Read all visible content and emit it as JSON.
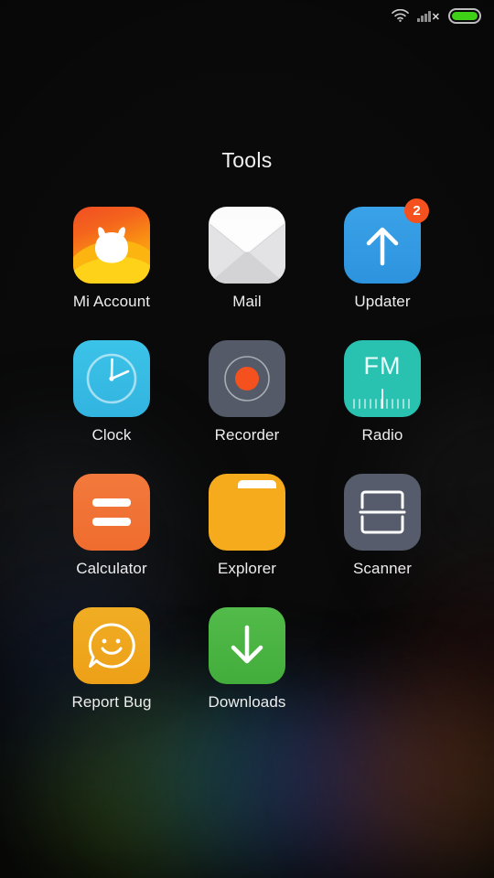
{
  "statusbar": {
    "wifi_icon": "wifi-icon",
    "signal_icon": "signal-bars-icon",
    "no_sim_mark": "✕",
    "battery_icon": "battery-full-icon"
  },
  "page": {
    "title": "Tools"
  },
  "apps": [
    {
      "label": "Mi Account",
      "icon": "mi-account-icon",
      "badge": null
    },
    {
      "label": "Mail",
      "icon": "mail-envelope-icon",
      "badge": null
    },
    {
      "label": "Updater",
      "icon": "updater-up-arrow-icon",
      "badge": "2"
    },
    {
      "label": "Clock",
      "icon": "clock-face-icon",
      "badge": null
    },
    {
      "label": "Recorder",
      "icon": "record-dot-icon",
      "badge": null
    },
    {
      "label": "Radio",
      "icon": "fm-radio-icon",
      "badge": null,
      "fm_text": "FM"
    },
    {
      "label": "Calculator",
      "icon": "equals-sign-icon",
      "badge": null
    },
    {
      "label": "Explorer",
      "icon": "folder-icon",
      "badge": null
    },
    {
      "label": "Scanner",
      "icon": "scanner-bars-icon",
      "badge": null
    },
    {
      "label": "Report Bug",
      "icon": "smiley-speech-bubble-icon",
      "badge": null
    },
    {
      "label": "Downloads",
      "icon": "download-arrow-icon",
      "badge": null
    }
  ],
  "colors": {
    "badge": "#f4511e",
    "updater": "#2d93de",
    "clock": "#32b4e0",
    "recorder": "#545a68",
    "radio": "#29c2b0",
    "calculator": "#ef6d2e",
    "explorer": "#f5ab1b",
    "scanner": "#565c6b",
    "report_bug": "#eda017",
    "downloads": "#43ad3c",
    "battery": "#3fd018",
    "background": "#0a0a0a"
  }
}
